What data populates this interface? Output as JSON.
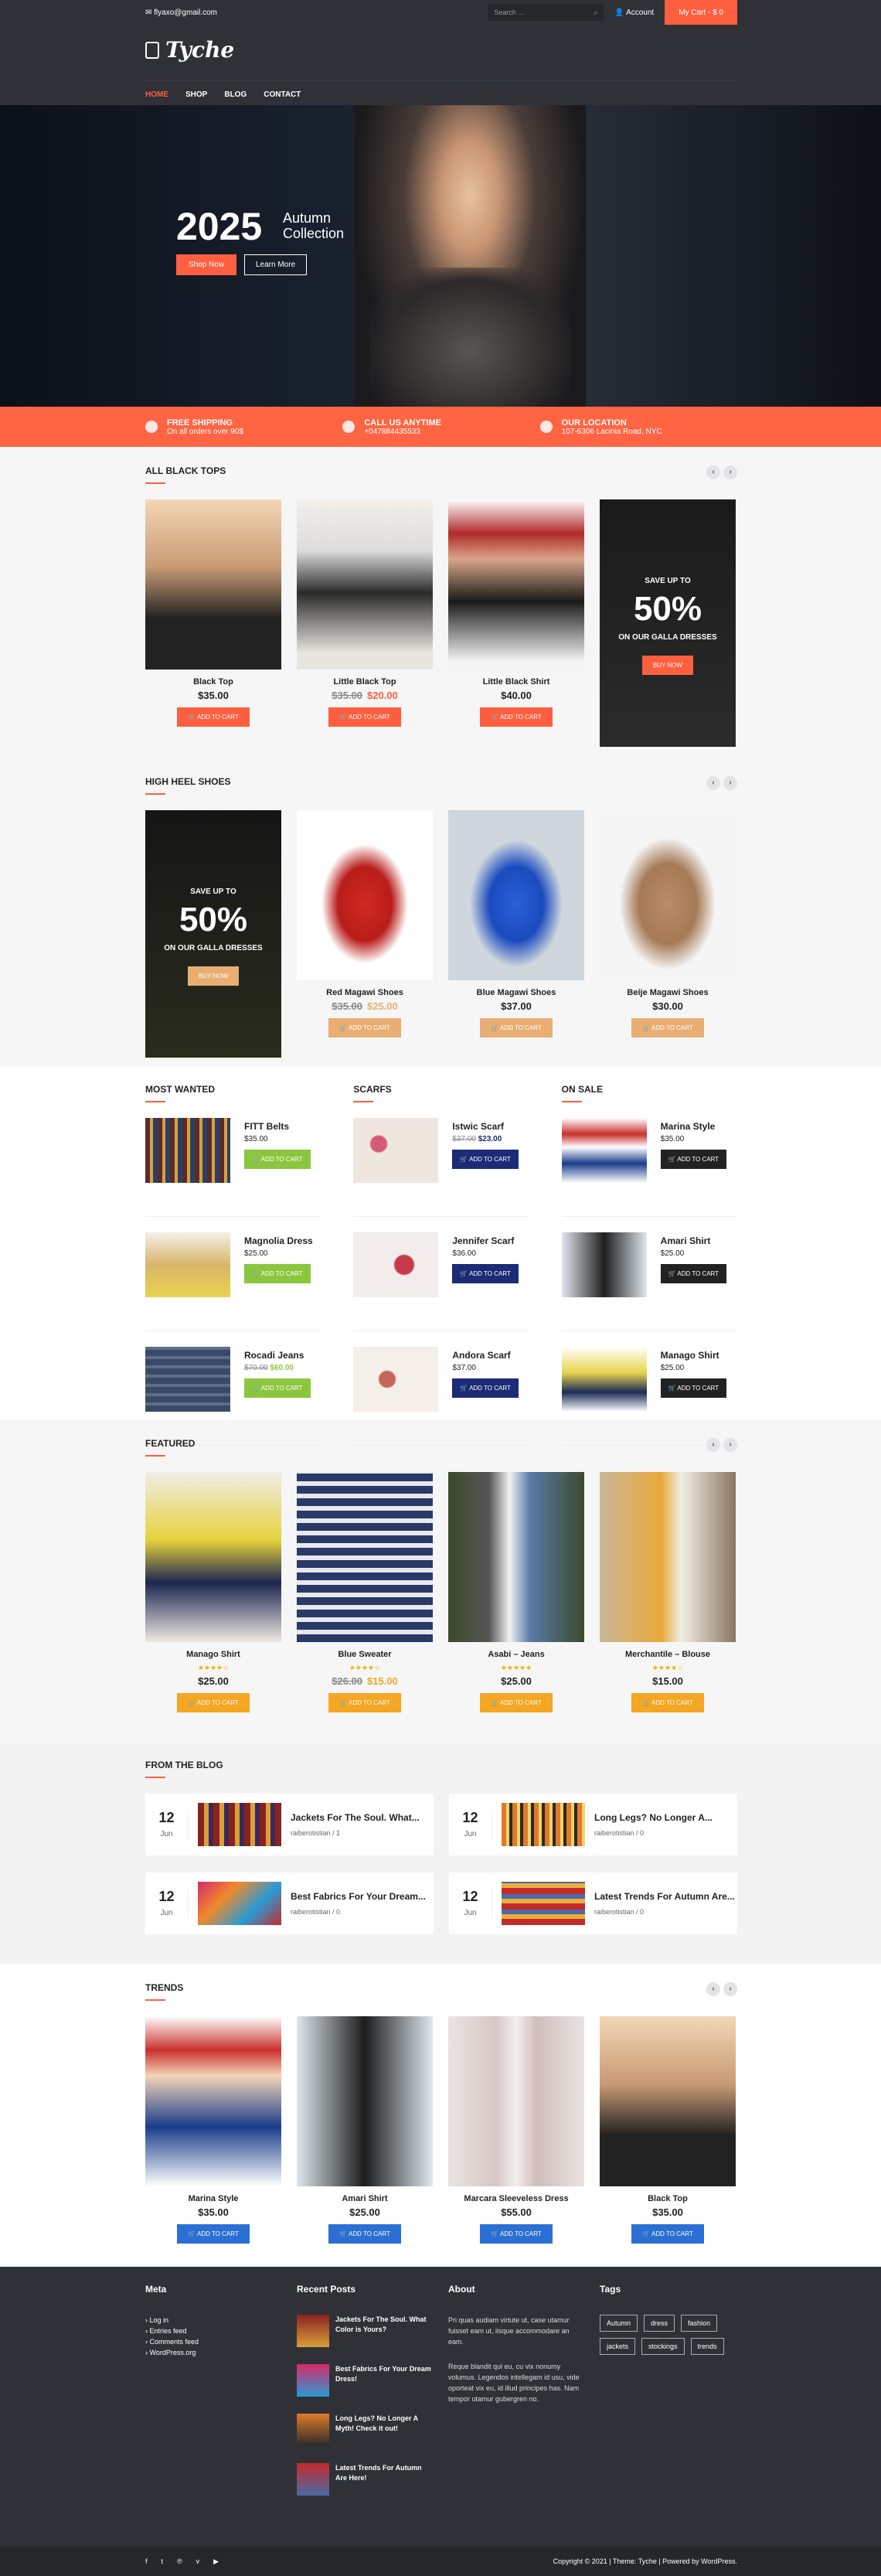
{
  "topbar": {
    "email": "✉ flyaxo@gmail.com",
    "search_placeholder": "Search ...",
    "account": "Account",
    "cart": "My Cart - $ 0"
  },
  "header": {
    "logo": "Tyche",
    "nav": [
      "HOME",
      "SHOP",
      "BLOG",
      "CONTACT"
    ]
  },
  "hero": {
    "year": "2025",
    "title_line1": "Autumn",
    "title_line2": "Collection",
    "btn_shop": "Shop Now",
    "btn_learn": "Learn More"
  },
  "info": [
    {
      "title": "FREE SHIPPING",
      "text": "On all orders over 90$"
    },
    {
      "title": "CALL US ANYTIME",
      "text": "+047884435533"
    },
    {
      "title": "OUR LOCATION",
      "text": "107-6306 Lacinia Road, NYC"
    }
  ],
  "colors": {
    "accent": "#ff5f3f",
    "orange_btn": "#ff5f3f",
    "green": "#8cc63f",
    "navy": "#1b2b75",
    "dark": "#222222",
    "yellow": "#f5a623",
    "blue": "#2b6fd4",
    "light_orange": "#e8ae73"
  },
  "black_tops": {
    "title": "ALL BLACK TOPS",
    "items": [
      {
        "name": "Black Top",
        "price": "$35.00",
        "old": "",
        "sale": ""
      },
      {
        "name": "Little Black Top",
        "price": "",
        "old": "$35.00",
        "sale": "$20.00"
      },
      {
        "name": "Little Black Shirt",
        "price": "$40.00",
        "old": "",
        "sale": ""
      }
    ],
    "promo": {
      "up": "SAVE UP TO",
      "pct": "50%",
      "on": "ON OUR GALLA DRESSES",
      "btn": "BUY NOW"
    },
    "btn": "🛒 ADD TO CART"
  },
  "shoes": {
    "title": "HIGH HEEL SHOES",
    "promo": {
      "up": "SAVE UP TO",
      "pct": "50%",
      "on": "ON OUR GALLA DRESSES",
      "btn": "BUY NOW"
    },
    "items": [
      {
        "name": "Red Magawi Shoes",
        "price": "",
        "old": "$35.00",
        "sale": "$25.00"
      },
      {
        "name": "Blue Magawi Shoes",
        "price": "$37.00",
        "old": "",
        "sale": ""
      },
      {
        "name": "Beije Magawi Shoes",
        "price": "$30.00",
        "old": "",
        "sale": ""
      }
    ],
    "btn": "🛒 ADD TO CART"
  },
  "lists": [
    {
      "title": "MOST WANTED",
      "items": [
        {
          "name": "FITT Belts",
          "price": "$35.00",
          "old": "",
          "sale": ""
        },
        {
          "name": "Magnolia Dress",
          "price": "$25.00",
          "old": "",
          "sale": ""
        },
        {
          "name": "Rocadi Jeans",
          "price": "",
          "old": "$70.00",
          "sale": "$60.00"
        }
      ]
    },
    {
      "title": "SCARFS",
      "items": [
        {
          "name": "Istwic Scarf",
          "price": "",
          "old": "$37.00",
          "sale": "$23.00"
        },
        {
          "name": "Jennifer Scarf",
          "price": "$36.00",
          "old": "",
          "sale": ""
        },
        {
          "name": "Andora Scarf",
          "price": "$37.00",
          "old": "",
          "sale": ""
        }
      ]
    },
    {
      "title": "ON SALE",
      "items": [
        {
          "name": "Marina Style",
          "price": "$35.00",
          "old": "",
          "sale": ""
        },
        {
          "name": "Amari Shirt",
          "price": "$25.00",
          "old": "",
          "sale": ""
        },
        {
          "name": "Manago Shirt",
          "price": "$25.00",
          "old": "",
          "sale": ""
        }
      ]
    }
  ],
  "featured": {
    "title": "FEATURED",
    "items": [
      {
        "name": "Manago Shirt",
        "price": "$25.00",
        "old": "",
        "sale": "",
        "rating": 4
      },
      {
        "name": "Blue Sweater",
        "price": "",
        "old": "$26.00",
        "sale": "$15.00",
        "rating": 4
      },
      {
        "name": "Asabi – Jeans",
        "price": "$25.00",
        "old": "",
        "sale": "",
        "rating": 5
      },
      {
        "name": "Merchantile – Blouse",
        "price": "$15.00",
        "old": "",
        "sale": "",
        "rating": 4
      }
    ],
    "btn": "🛒 ADD TO CART"
  },
  "blog": {
    "title": "FROM THE BLOG",
    "posts": [
      {
        "day": "12",
        "month": "Jun",
        "title": "Jackets For The Soul. What...",
        "meta": "raiberotistian / 1"
      },
      {
        "day": "12",
        "month": "Jun",
        "title": "Long Legs? No Longer A...",
        "meta": "raiberotistian / 0"
      },
      {
        "day": "12",
        "month": "Jun",
        "title": "Best Fabrics For Your Dream...",
        "meta": "raiberotistian / 0"
      },
      {
        "day": "12",
        "month": "Jun",
        "title": "Latest Trends For Autumn Are...",
        "meta": "raiberotistian / 0"
      }
    ]
  },
  "trends": {
    "title": "TRENDS",
    "items": [
      {
        "name": "Marina Style",
        "price": "$35.00"
      },
      {
        "name": "Amari Shirt",
        "price": "$25.00"
      },
      {
        "name": "Marcara Sleeveless Dress",
        "price": "$55.00"
      },
      {
        "name": "Black Top",
        "price": "$35.00"
      }
    ],
    "btn": "🛒 ADD TO CART"
  },
  "footer": {
    "meta_title": "Meta",
    "meta_links": [
      "Log in",
      "Entries feed",
      "Comments feed",
      "WordPress.org"
    ],
    "recent_title": "Recent Posts",
    "recent": [
      "Jackets For The Soul. What Color is Yours?",
      "Best Fabrics For Your Dream Dress!",
      "Long Legs? No Longer A Myth! Check it out!",
      "Latest Trends For Autumn Are Here!"
    ],
    "about_title": "About",
    "about_1": "Pri quas audiam virtute ut, case utamur fuisset eam ut, iisque accommodare an eam.",
    "about_2": "Reque blandit qui eu, cu vix nonumy volumus. Legendos intellegam id usu, vide oporteat vix eu, id illud principes has. Nam tempor utamur gubergren no.",
    "tags_title": "Tags",
    "tags": [
      "Autumn",
      "dress",
      "fashion",
      "jackets",
      "stockings",
      "trends"
    ],
    "copyright": "Copyright © 2021  |  Theme: Tyche  |  Powered by WordPress."
  }
}
